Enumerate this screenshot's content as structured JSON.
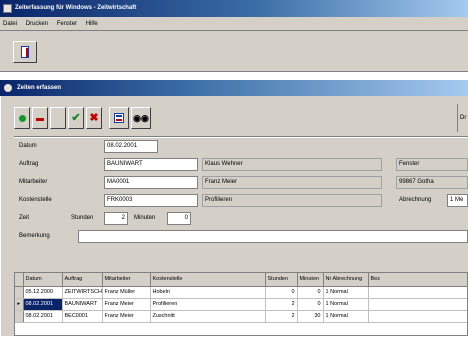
{
  "window": {
    "title": "Zeiterfassung für Windows - Zeitwirtschaft"
  },
  "menu": {
    "items": [
      "Datei",
      "Drucken",
      "Fenster",
      "Hilfe"
    ]
  },
  "child": {
    "title": "Zeiten erfassen"
  },
  "nav_tab": {
    "label": "Dr"
  },
  "form": {
    "datum_label": "Datum",
    "datum_value": "08.02.2001",
    "auftrag_label": "Auftrag",
    "auftrag_value": "BAUNIWART",
    "auftrag_desc": "Klaus Wehner",
    "auftrag_desc2": "Fenster",
    "mitarbeiter_label": "Mitarbeiter",
    "mitarbeiter_value": "MA0001",
    "mitarbeiter_name": "Franz Meier",
    "mitarbeiter_ort": "99867 Gotha",
    "kostenstelle_label": "Kostenstelle",
    "kostenstelle_value": "FRK0003",
    "kostenstelle_name": "Profilieren",
    "abrechnung_label": "Abrechnung",
    "abrechnung_value": "1 Me",
    "zeit_label": "Zeit",
    "stunden_label": "Stunden",
    "stunden_value": "2",
    "minuten_label": "Minuten",
    "minuten_value": "0",
    "bemerkung_label": "Bemerkung",
    "bemerkung_value": ""
  },
  "grid": {
    "headers": [
      "Datum",
      "Auftrag",
      "Mitarbeiter",
      "Kostenstelle",
      "Stunden",
      "Minuten",
      "Nr Abrechnung",
      "Bez"
    ],
    "rows": [
      {
        "marker": "",
        "cells": [
          "05.12.2000",
          "ZEITWIRTSCH",
          "Franz Müller",
          "Hobeln",
          "0",
          "0",
          "1 Normal",
          ""
        ]
      },
      {
        "marker": "▸",
        "cells": [
          "08.02.2001",
          "BAUNIWART",
          "Franz Meier",
          "Profilieren",
          "2",
          "0",
          "1 Normal",
          ""
        ]
      },
      {
        "marker": "",
        "cells": [
          "08.02.2001",
          "BEC0001",
          "Franz Meier",
          "Zuschnitt",
          "2",
          "30",
          "1 Normal",
          ""
        ]
      }
    ]
  }
}
